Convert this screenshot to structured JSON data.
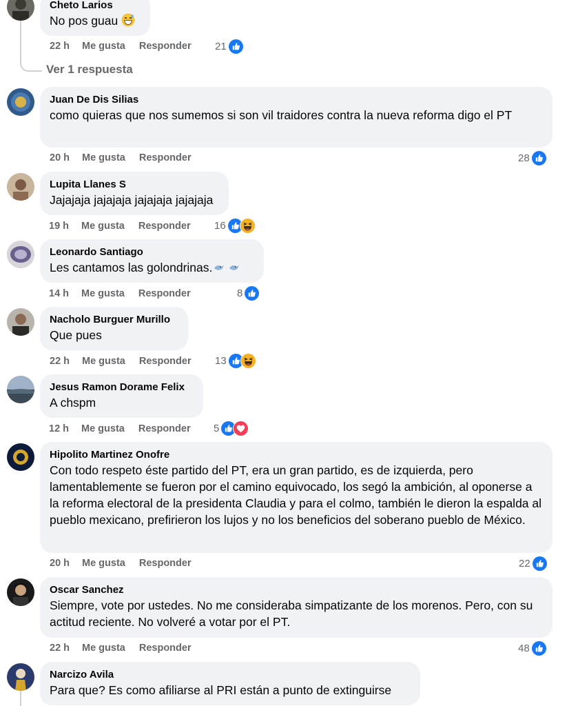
{
  "comments": [
    {
      "name": "Cheto Larios",
      "text": "No pos guau",
      "time": "22 h",
      "like": "Me gusta",
      "reply": "Responder",
      "count": "21"
    },
    {
      "name": "Juan De Dis Silias",
      "text": "como quieras que nos sumemos si son vil traidores contra la nueva reforma digo el PT",
      "time": "20 h",
      "like": "Me gusta",
      "reply": "Responder",
      "count": "28"
    },
    {
      "name": "Lupita Llanes S",
      "text": "Jajajaja jajajaja jajajaja jajajaja",
      "time": "19 h",
      "like": "Me gusta",
      "reply": "Responder",
      "count": "16"
    },
    {
      "name": "Leonardo Santiago",
      "text": "Les cantamos las golondrinas.",
      "time": "14 h",
      "like": "Me gusta",
      "reply": "Responder",
      "count": "8"
    },
    {
      "name": "Nacholo Burguer Murillo",
      "text": "Que pues",
      "time": "22 h",
      "like": "Me gusta",
      "reply": "Responder",
      "count": "13"
    },
    {
      "name": "Jesus Ramon Dorame Felix",
      "text": "A chspm",
      "time": "12 h",
      "like": "Me gusta",
      "reply": "Responder",
      "count": "5"
    },
    {
      "name": "Hipolito Martinez Onofre",
      "text": "Con todo respeto éste partido del PT, era un gran partido, es de izquierda, pero lamentablemente se fueron por el camino equivocado, los segó la ambición, al oponerse a la reforma electoral de la presidenta Claudia y para el colmo, también le dieron la espalda al pueblo mexicano, prefirieron los lujos y no los beneficios del soberano pueblo de México.",
      "time": "20 h",
      "like": "Me gusta",
      "reply": "Responder",
      "count": "22"
    },
    {
      "name": "Oscar Sanchez",
      "text": "Siempre, vote por ustedes. No me consideraba simpatizante de los morenos. Pero, con su actitud reciente. No volveré a votar por el PT.",
      "time": "22 h",
      "like": "Me gusta",
      "reply": "Responder",
      "count": "48"
    },
    {
      "name": "Narcizo Avila",
      "text": "Para que? Es como afiliarse al PRI están a punto de extinguirse"
    }
  ],
  "view_replies": "Ver 1 respuesta",
  "colors": {
    "like_blue": "#1877f2",
    "haha_yellow": "#f7b125",
    "love_red": "#f33e58",
    "bubble": "#f0f2f5",
    "meta": "#65676b"
  },
  "icons": {
    "like": "thumbs-up-icon",
    "haha": "laughing-emoji-icon",
    "love": "heart-icon",
    "sweat": "grinning-sweat-emoji-icon",
    "bird": "bird-emoji-icon"
  }
}
